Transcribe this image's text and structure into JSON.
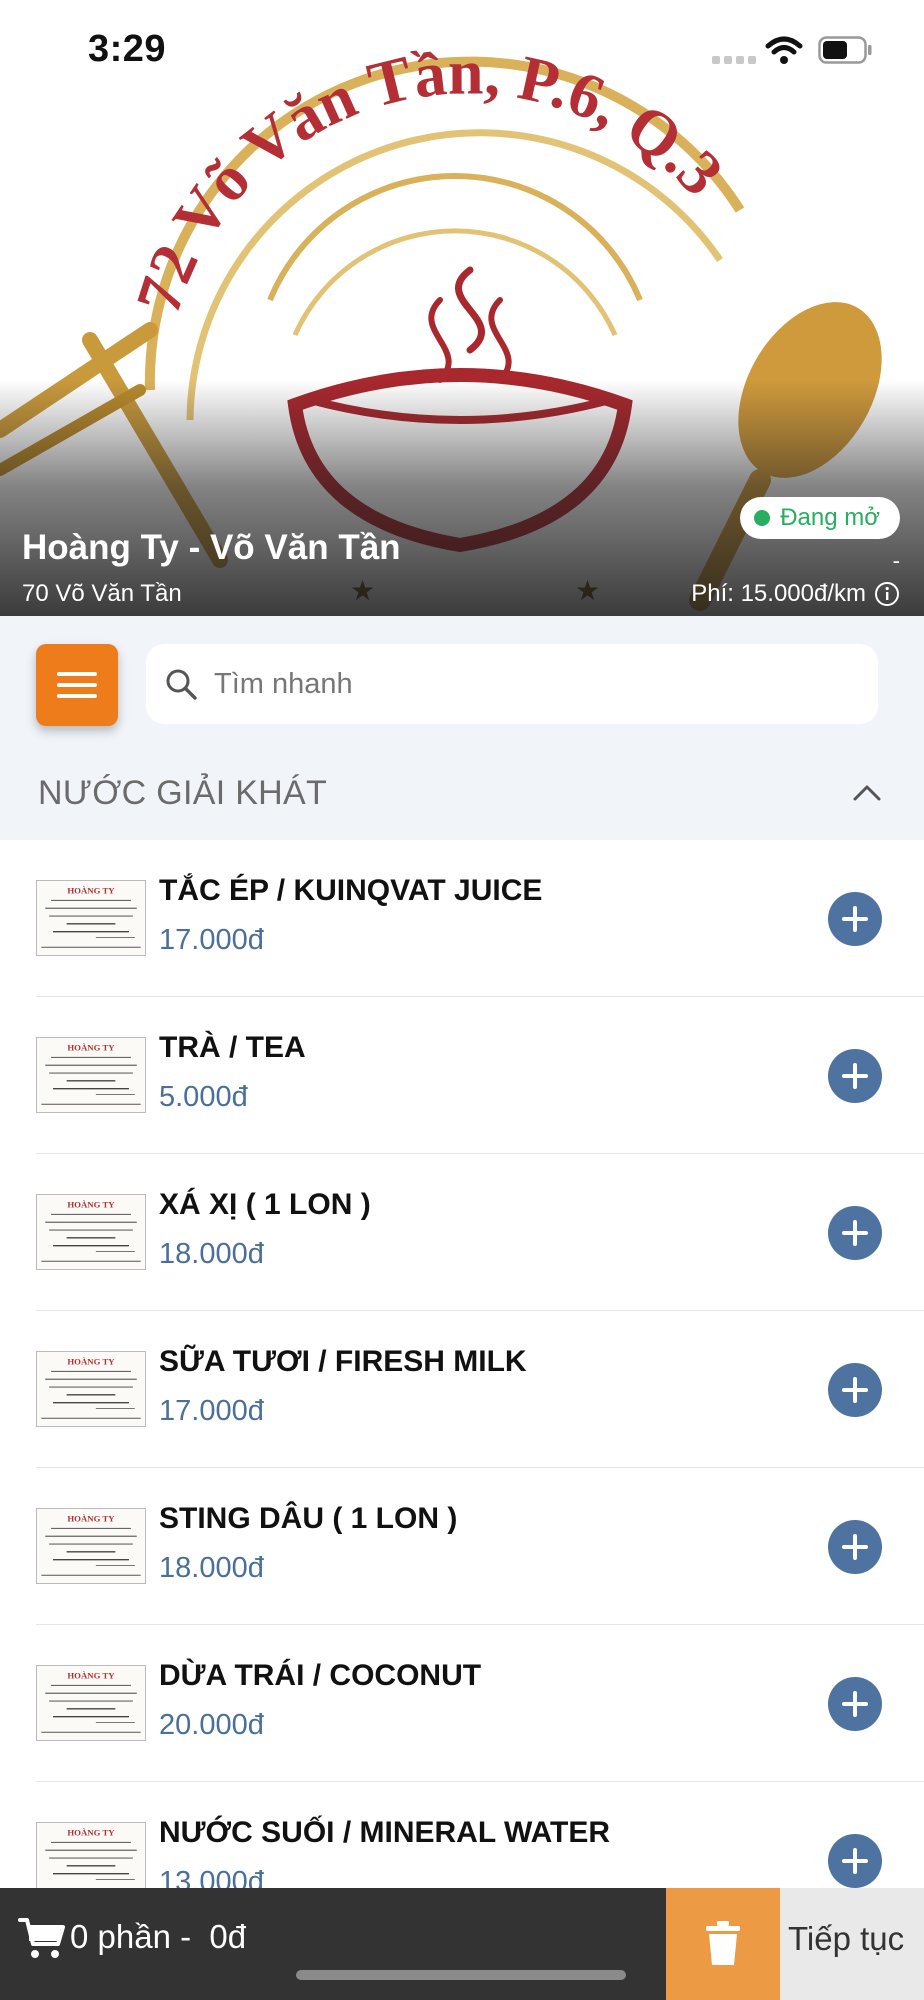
{
  "status_bar": {
    "time": "3:29"
  },
  "store": {
    "logo_text": "72 Võ Văn Tần, P.6, Q.3",
    "name": "Hoàng Ty - Võ Văn Tần",
    "address": "70 Võ Văn Tần",
    "status": "Đang mở",
    "distance": "-",
    "fee": "Phí: 15.000đ/km"
  },
  "search": {
    "placeholder": "Tìm nhanh"
  },
  "category": {
    "title": "NƯỚC GIẢI KHÁT"
  },
  "items": [
    {
      "name": "TẮC ÉP / KUINQVAT JUICE",
      "price": "17.000đ"
    },
    {
      "name": "TRÀ / TEA",
      "price": "5.000đ"
    },
    {
      "name": "XÁ XỊ ( 1 LON )",
      "price": "18.000đ"
    },
    {
      "name": "SỮA TƯƠI / FIRESH MILK",
      "price": "17.000đ"
    },
    {
      "name": "STING DÂU ( 1 LON )",
      "price": "18.000đ"
    },
    {
      "name": "DỪA TRÁI / COCONUT",
      "price": "20.000đ"
    },
    {
      "name": "NƯỚC SUỐI / MINERAL WATER",
      "price": "13.000đ"
    }
  ],
  "thumbnail": {
    "brand": "HOÀNG TY"
  },
  "cart": {
    "summary": "0 phần -  0đ",
    "continue_label": "Tiếp tục"
  },
  "colors": {
    "accent": "#ef7c1a",
    "add_button": "#4f73a0",
    "price": "#4a6f9a",
    "open": "#27ae60",
    "bottom_bar": "#333333",
    "trash": "#ed9a45"
  },
  "icons": {
    "menu": "hamburger-icon",
    "search": "search-icon",
    "collapse": "chevron-up-icon",
    "add": "plus-circle-icon",
    "cart": "cart-icon",
    "trash": "trash-icon",
    "info": "info-icon"
  }
}
